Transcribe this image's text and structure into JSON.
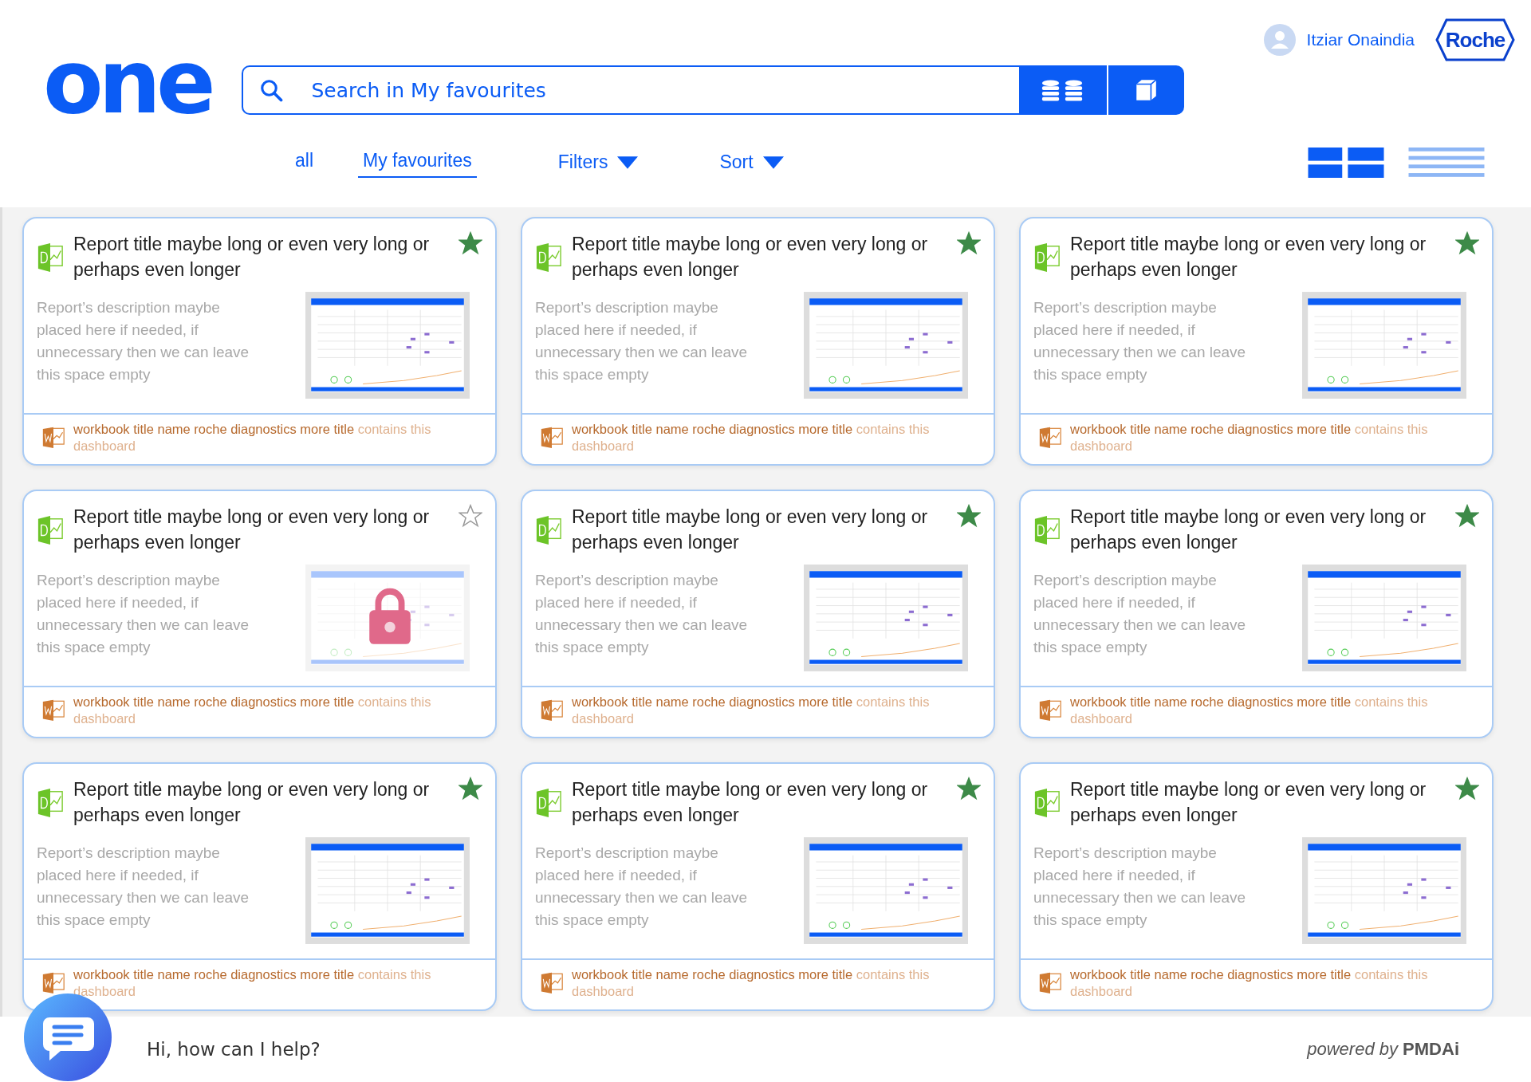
{
  "logo": "one",
  "search": {
    "placeholder": "Search in My favourites"
  },
  "user": {
    "name": "Itziar Onaindia"
  },
  "brand": {
    "label": "Roche"
  },
  "tabs": [
    {
      "label": "all",
      "selected": false
    },
    {
      "label": "My favourites",
      "selected": true
    }
  ],
  "dropdowns": [
    {
      "label": "Filters"
    },
    {
      "label": "Sort"
    }
  ],
  "view_modes": [
    {
      "kind": "grid",
      "selected": true
    },
    {
      "kind": "list",
      "selected": false
    }
  ],
  "cards": [
    {
      "title": "Report title maybe long or even very long or perhaps even longer",
      "description": "Report’s description maybe placed here if needed, if unnecessary then we can leave this space empty",
      "workbook": "workbook title name roche diagnostics more title",
      "note": "contains this dashboard",
      "starred": true,
      "locked": false
    },
    {
      "title": "Report title maybe long or even very long or perhaps even longer",
      "description": "Report’s description maybe placed here if needed, if unnecessary then we can leave this space empty",
      "workbook": "workbook title name roche diagnostics more title",
      "note": "contains this dashboard",
      "starred": true,
      "locked": false
    },
    {
      "title": "Report title maybe long or even very long or perhaps even longer",
      "description": "Report’s description maybe placed here if needed, if unnecessary then we can leave this space empty",
      "workbook": "workbook title name roche diagnostics more title",
      "note": "contains this dashboard",
      "starred": true,
      "locked": false
    },
    {
      "title": "Report title maybe long or even very long or perhaps even longer",
      "description": "Report’s description maybe placed here if needed, if unnecessary then we can leave this space empty",
      "workbook": "workbook title name roche diagnostics more title",
      "note": "contains this dashboard",
      "starred": false,
      "locked": true
    },
    {
      "title": "Report title maybe long or even very long or perhaps even longer",
      "description": "Report’s description maybe placed here if needed, if unnecessary then we can leave this space empty",
      "workbook": "workbook title name roche diagnostics more title",
      "note": "contains this dashboard",
      "starred": true,
      "locked": false
    },
    {
      "title": "Report title maybe long or even very long or perhaps even longer",
      "description": "Report’s description maybe placed here if needed, if unnecessary then we can leave this space empty",
      "workbook": "workbook title name roche diagnostics more title",
      "note": "contains this dashboard",
      "starred": true,
      "locked": false
    },
    {
      "title": "Report title maybe long or even very long or perhaps even longer",
      "description": "Report’s description maybe placed here if needed, if unnecessary then we can leave this space empty",
      "workbook": "workbook title name roche diagnostics more title",
      "note": "contains this dashboard",
      "starred": true,
      "locked": false
    },
    {
      "title": "Report title maybe long or even very long or perhaps even longer",
      "description": "Report’s description maybe placed here if needed, if unnecessary then we can leave this space empty",
      "workbook": "workbook title name roche diagnostics more title",
      "note": "contains this dashboard",
      "starred": true,
      "locked": false
    },
    {
      "title": "Report title maybe long or even very long or perhaps even longer",
      "description": "Report’s description maybe placed here if needed, if unnecessary then we can leave this space empty",
      "workbook": "workbook title name roche diagnostics more title",
      "note": "contains this dashboard",
      "starred": true,
      "locked": false
    }
  ],
  "chat": {
    "prompt": "Hi, how can I help?",
    "credit": "*powered by* **PMDAi**"
  }
}
